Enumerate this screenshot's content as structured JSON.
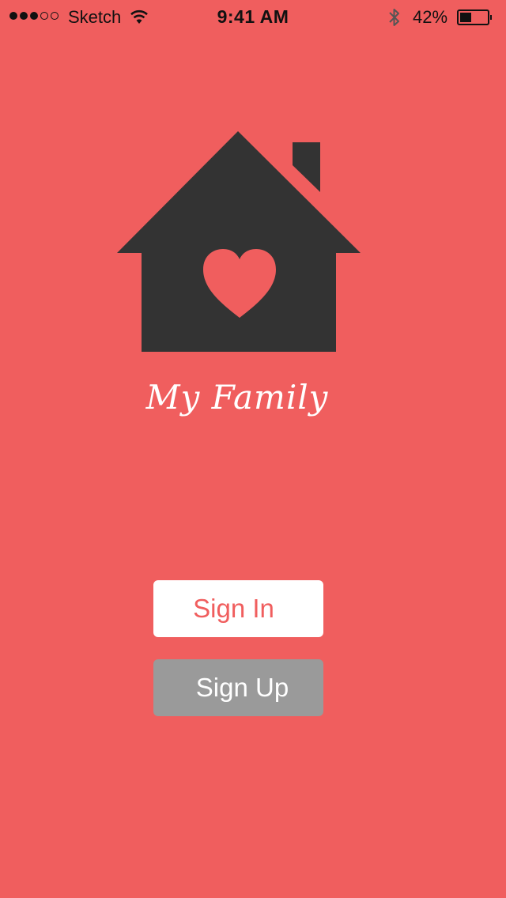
{
  "status_bar": {
    "carrier": "Sketch",
    "time": "9:41 AM",
    "battery_percent": "42%",
    "battery_level": 0.42,
    "signal_bars_filled": 3,
    "signal_bars_total": 5
  },
  "app": {
    "name": "My Family",
    "logo_icon": "house-heart-icon"
  },
  "actions": {
    "sign_in_label": "Sign In",
    "sign_up_label": "Sign Up"
  },
  "colors": {
    "background": "#F05E5E",
    "house": "#333333",
    "sign_in_bg": "#FFFFFF",
    "sign_in_text": "#F05E5E",
    "sign_up_bg": "#9A9A9A",
    "sign_up_text": "#FFFFFF"
  }
}
